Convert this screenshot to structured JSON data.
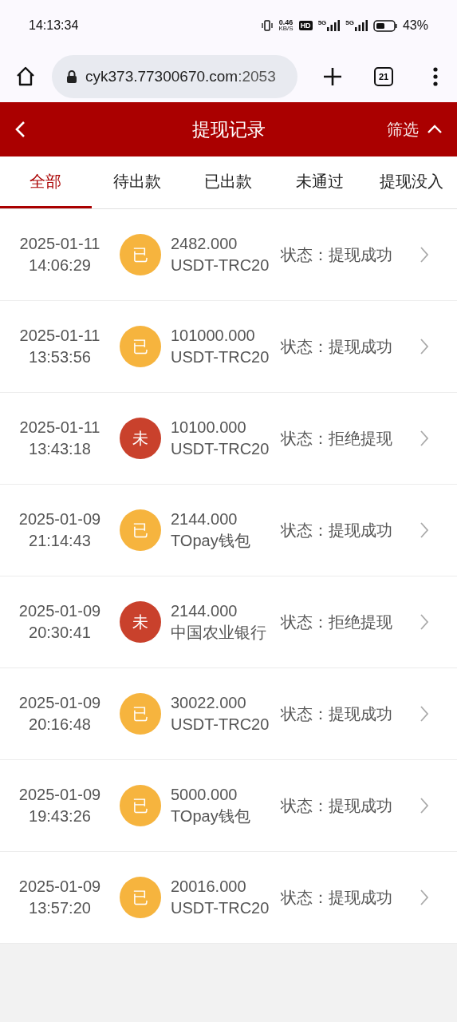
{
  "status_bar": {
    "time": "14:13:34",
    "speed": "0.46",
    "speed_unit": "KB/S",
    "hd": "HD",
    "network_1": "5G",
    "network_2": "5G",
    "battery": "43%"
  },
  "browser": {
    "url_host": "cyk373.77300670.com",
    "url_port": ":2053",
    "tab_count": "21"
  },
  "header": {
    "title": "提现记录",
    "filter": "筛选"
  },
  "tabs": [
    {
      "label": "全部",
      "selected": true
    },
    {
      "label": "待出款",
      "selected": false
    },
    {
      "label": "已出款",
      "selected": false
    },
    {
      "label": "未通过",
      "selected": false
    },
    {
      "label": "提现没入",
      "selected": false
    }
  ],
  "records": [
    {
      "date": "2025-01-11",
      "time": "14:06:29",
      "badge": "已",
      "kind": "done",
      "amount": "2482.000",
      "method": "USDT-TRC20",
      "status_label": "状态：",
      "status": "提现成功"
    },
    {
      "date": "2025-01-11",
      "time": "13:53:56",
      "badge": "已",
      "kind": "done",
      "amount": "101000.000",
      "method": "USDT-TRC20",
      "status_label": "状态：",
      "status": "提现成功"
    },
    {
      "date": "2025-01-11",
      "time": "13:43:18",
      "badge": "未",
      "kind": "rejected",
      "amount": "10100.000",
      "method": "USDT-TRC20",
      "status_label": "状态：",
      "status": "拒绝提现"
    },
    {
      "date": "2025-01-09",
      "time": "21:14:43",
      "badge": "已",
      "kind": "done",
      "amount": "2144.000",
      "method": "TOpay钱包",
      "status_label": "状态：",
      "status": "提现成功"
    },
    {
      "date": "2025-01-09",
      "time": "20:30:41",
      "badge": "未",
      "kind": "rejected",
      "amount": "2144.000",
      "method": "中国农业银行",
      "status_label": "状态：",
      "status": "拒绝提现"
    },
    {
      "date": "2025-01-09",
      "time": "20:16:48",
      "badge": "已",
      "kind": "done",
      "amount": "30022.000",
      "method": "USDT-TRC20",
      "status_label": "状态：",
      "status": "提现成功"
    },
    {
      "date": "2025-01-09",
      "time": "19:43:26",
      "badge": "已",
      "kind": "done",
      "amount": "5000.000",
      "method": "TOpay钱包",
      "status_label": "状态：",
      "status": "提现成功"
    },
    {
      "date": "2025-01-09",
      "time": "13:57:20",
      "badge": "已",
      "kind": "done",
      "amount": "20016.000",
      "method": "USDT-TRC20",
      "status_label": "状态：",
      "status": "提现成功"
    }
  ]
}
